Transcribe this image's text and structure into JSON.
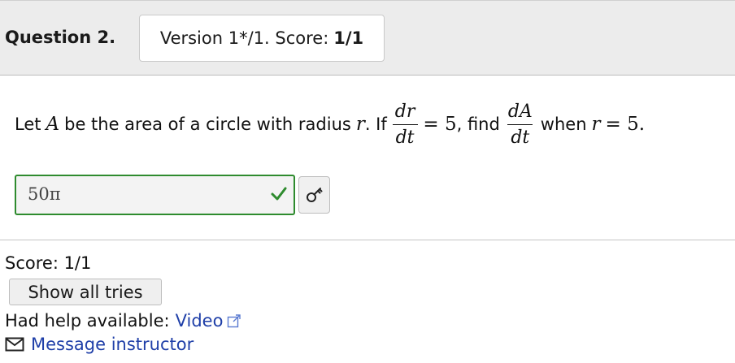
{
  "header": {
    "question_label": "Question 2.",
    "version_text": "Version 1*/1. Score:",
    "version_score": "1/1"
  },
  "question": {
    "t1": "Let",
    "var_A": "A",
    "t2": "be the area of a circle with radius",
    "var_r": "r",
    "t3": ". If",
    "frac1_num": "dr",
    "frac1_den": "dt",
    "eq1": "= 5",
    "t4": ", find",
    "frac2_num": "dA",
    "frac2_den": "dt",
    "t5": "when",
    "var_r2": "r",
    "eq2": "= 5."
  },
  "answer": {
    "value": "50π",
    "status": "correct"
  },
  "score_text": "Score: 1/1",
  "show_all_label": "Show all tries",
  "help": {
    "label": "Had help available:",
    "video_label": "Video"
  },
  "message_label": "Message instructor",
  "colors": {
    "correct": "#2e8b2e",
    "link": "#1f3fa8",
    "header_bg": "#ececec"
  },
  "icons": [
    "checkmark-icon",
    "key-icon",
    "external-link-icon",
    "envelope-icon"
  ]
}
